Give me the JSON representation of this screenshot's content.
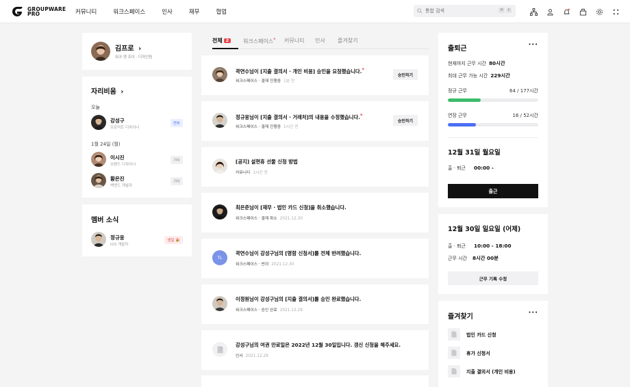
{
  "app": {
    "logo_line1": "GROUPWARE",
    "logo_line2": "PRO"
  },
  "nav": [
    "커뮤니티",
    "워크스페이스",
    "인사",
    "재무",
    "협업"
  ],
  "search": {
    "placeholder": "통합 검색",
    "shortcut": [
      "⌘",
      "K"
    ]
  },
  "top_icons": [
    "org-chart-icon",
    "user-group-icon",
    "bell-icon",
    "building-icon",
    "settings-icon",
    "apps-grid-icon"
  ],
  "profile": {
    "name": "김프로",
    "chevron": "›",
    "subtitle": "워크 앤 조이 · 디자인팀"
  },
  "away": {
    "title": "자리비움",
    "today_label": "오늘",
    "today": [
      {
        "name": "강성구",
        "role": "프로덕트 디자이너",
        "tag": "연차"
      }
    ],
    "date_label": "1월 24일 (월)",
    "date": [
      {
        "name": "이시진",
        "role": "브랜드 디자이너",
        "tag": "기타"
      },
      {
        "name": "황은진",
        "role": "백엔드 개발자",
        "tag": "기타"
      }
    ]
  },
  "member_news": {
    "title": "멤버 소식",
    "items": [
      {
        "name": "정규웅",
        "role": "iOS 개발자",
        "tag": "생일 🎉"
      }
    ]
  },
  "tabs": [
    {
      "label": "전체",
      "count": "2"
    },
    {
      "label": "워크스페이스",
      "dot": "*"
    },
    {
      "label": "커뮤니티"
    },
    {
      "label": "인사"
    },
    {
      "label": "즐겨찾기"
    }
  ],
  "feed": [
    {
      "title": "곽연수님이 [지출 결의서 · 개인 비용] 승인을 요청했습니다.",
      "dot": "*",
      "meta": "워크스페이스 · 결재 진행중",
      "time": "1분 전",
      "button": "승인하기"
    },
    {
      "title": "정규웅님이 [지출 결의서 · 거래처]의 내용을 수정했습니다.",
      "dot": "*",
      "meta": "워크스페이스 · 결재 진행중",
      "time": "1시간 전",
      "button": "승인하기"
    },
    {
      "title": "[공지] 설현휴 선물 신청 방법",
      "meta": "커뮤니티",
      "time": "1시간 전"
    },
    {
      "title": "최은준님이 [재무 · 법인 카드 신청]을 취소했습니다.",
      "meta": "워크스페이스 · 결재 취소",
      "time": "2021.12.30"
    },
    {
      "title": "곽연수님이 강성구님의 [명함 신청서]를 전체 반려했습니다.",
      "meta": "워크스페이스 · 반려",
      "time": "2021.12.30",
      "initials": "TL"
    },
    {
      "title": "이정원님이 강성구님의 [지출 결의서]를 승인 완료했습니다.",
      "meta": "워크스페이스 · 승인 완료",
      "time": "2021.12.29"
    },
    {
      "title": "강성구님의 여권 만료일은 2022년 12월 30일입니다. 갱신 신청을 해주세요.",
      "meta": "인사",
      "time": "2021.12.29"
    }
  ],
  "attendance": {
    "title": "출퇴근",
    "more": "···",
    "rows": [
      {
        "label": "현재까지 근무 시간",
        "value": "80시간"
      },
      {
        "label": "최대 근무 가능 시간",
        "value": "229시간"
      }
    ],
    "regular": {
      "label": "정규 근무",
      "value": "64 / 177시간",
      "progress": 0.36,
      "color": "#3dbb6a"
    },
    "overtime": {
      "label": "연장 근무",
      "value": "16 / 52시간",
      "progress": 0.31,
      "color": "#4c6ef5"
    },
    "today_title": "12월 31일 월요일",
    "today_row": {
      "label": "출 · 퇴근",
      "value": "00:00 -"
    },
    "button": "출근"
  },
  "yesterday": {
    "title": "12월 30일 일요일 (어제)",
    "rows": [
      {
        "label": "출 · 퇴근",
        "value": "10:00 - 18:00"
      },
      {
        "label": "근무 시간",
        "value": "8시간 00분"
      }
    ],
    "button": "근무 기록 수정"
  },
  "favorites": {
    "title": "즐겨찾기",
    "more": "···",
    "items": [
      "법인 카드 신청",
      "휴가 신청서",
      "지출 결의서 (개인 비용)"
    ]
  }
}
